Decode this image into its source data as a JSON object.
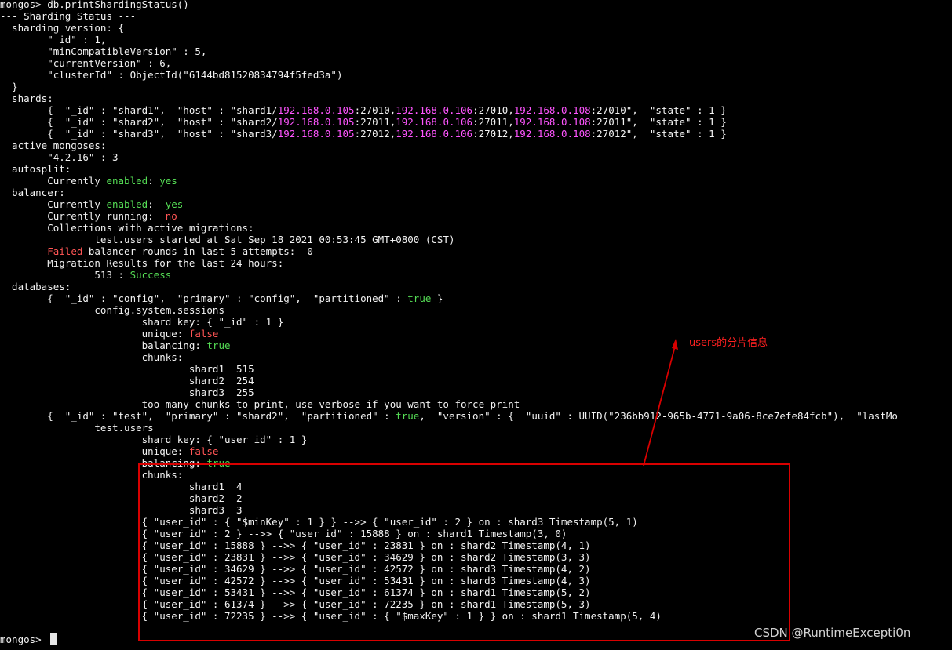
{
  "colors": {
    "background": "#000000",
    "text": "#f2f2f2",
    "ip_address": "#ff55ff",
    "positive": "#55dd55",
    "negative": "#ff5555",
    "annotation": "#d90000"
  },
  "terminal": {
    "lines": [
      [
        {
          "t": "mongos> db.printShardingStatus()",
          "c": "default"
        }
      ],
      [
        {
          "t": "--- Sharding Status --- ",
          "c": "default"
        }
      ],
      [
        {
          "t": "  sharding version: {",
          "c": "default"
        }
      ],
      [
        {
          "t": "        \"_id\" : 1,",
          "c": "default"
        }
      ],
      [
        {
          "t": "        \"minCompatibleVersion\" : 5,",
          "c": "default"
        }
      ],
      [
        {
          "t": "        \"currentVersion\" : 6,",
          "c": "default"
        }
      ],
      [
        {
          "t": "        \"clusterId\" : ObjectId(\"6144bd81520834794f5fed3a\")",
          "c": "default"
        }
      ],
      [
        {
          "t": "  }",
          "c": "default"
        }
      ],
      [
        {
          "t": "  shards:",
          "c": "default"
        }
      ],
      [
        {
          "t": "        {  \"_id\" : \"shard1\",  \"host\" : \"shard1/",
          "c": "default"
        },
        {
          "t": "192.168.0.105",
          "c": "ip"
        },
        {
          "t": ":27010,",
          "c": "default"
        },
        {
          "t": "192.168.0.106",
          "c": "ip"
        },
        {
          "t": ":27010,",
          "c": "default"
        },
        {
          "t": "192.168.0.108",
          "c": "ip"
        },
        {
          "t": ":27010\",  \"state\" : 1 }",
          "c": "default"
        }
      ],
      [
        {
          "t": "        {  \"_id\" : \"shard2\",  \"host\" : \"shard2/",
          "c": "default"
        },
        {
          "t": "192.168.0.105",
          "c": "ip"
        },
        {
          "t": ":27011,",
          "c": "default"
        },
        {
          "t": "192.168.0.106",
          "c": "ip"
        },
        {
          "t": ":27011,",
          "c": "default"
        },
        {
          "t": "192.168.0.108",
          "c": "ip"
        },
        {
          "t": ":27011\",  \"state\" : 1 }",
          "c": "default"
        }
      ],
      [
        {
          "t": "        {  \"_id\" : \"shard3\",  \"host\" : \"shard3/",
          "c": "default"
        },
        {
          "t": "192.168.0.105",
          "c": "ip"
        },
        {
          "t": ":27012,",
          "c": "default"
        },
        {
          "t": "192.168.0.106",
          "c": "ip"
        },
        {
          "t": ":27012,",
          "c": "default"
        },
        {
          "t": "192.168.0.108",
          "c": "ip"
        },
        {
          "t": ":27012\",  \"state\" : 1 }",
          "c": "default"
        }
      ],
      [
        {
          "t": "  active mongoses:",
          "c": "default"
        }
      ],
      [
        {
          "t": "        \"4.2.16\" : 3",
          "c": "default"
        }
      ],
      [
        {
          "t": "  autosplit:",
          "c": "default"
        }
      ],
      [
        {
          "t": "        Currently ",
          "c": "default"
        },
        {
          "t": "enabled",
          "c": "green"
        },
        {
          "t": ": ",
          "c": "default"
        },
        {
          "t": "yes",
          "c": "green"
        }
      ],
      [
        {
          "t": "  balancer:",
          "c": "default"
        }
      ],
      [
        {
          "t": "        Currently ",
          "c": "default"
        },
        {
          "t": "enabled",
          "c": "green"
        },
        {
          "t": ":  ",
          "c": "default"
        },
        {
          "t": "yes",
          "c": "green"
        }
      ],
      [
        {
          "t": "        Currently running:  ",
          "c": "default"
        },
        {
          "t": "no",
          "c": "red"
        }
      ],
      [
        {
          "t": "        Collections with active migrations: ",
          "c": "default"
        }
      ],
      [
        {
          "t": "                test.users started at Sat Sep 18 2021 00:53:45 GMT+0800 (CST)",
          "c": "default"
        }
      ],
      [
        {
          "t": "        ",
          "c": "default"
        },
        {
          "t": "Failed",
          "c": "red"
        },
        {
          "t": " balancer rounds in last 5 attempts:  0",
          "c": "default"
        }
      ],
      [
        {
          "t": "        Migration Results for the last 24 hours: ",
          "c": "default"
        }
      ],
      [
        {
          "t": "                513 : ",
          "c": "default"
        },
        {
          "t": "Success",
          "c": "green"
        }
      ],
      [
        {
          "t": "  databases:",
          "c": "default"
        }
      ],
      [
        {
          "t": "        {  \"_id\" : \"config\",  \"primary\" : \"config\",  \"partitioned\" : ",
          "c": "default"
        },
        {
          "t": "true",
          "c": "green"
        },
        {
          "t": " }",
          "c": "default"
        }
      ],
      [
        {
          "t": "                config.system.sessions",
          "c": "default"
        }
      ],
      [
        {
          "t": "                        shard key: { \"_id\" : 1 }",
          "c": "default"
        }
      ],
      [
        {
          "t": "                        unique: ",
          "c": "default"
        },
        {
          "t": "false",
          "c": "red"
        }
      ],
      [
        {
          "t": "                        balancing: ",
          "c": "default"
        },
        {
          "t": "true",
          "c": "green"
        }
      ],
      [
        {
          "t": "                        chunks:",
          "c": "default"
        }
      ],
      [
        {
          "t": "                                shard1  515",
          "c": "default"
        }
      ],
      [
        {
          "t": "                                shard2  254",
          "c": "default"
        }
      ],
      [
        {
          "t": "                                shard3  255",
          "c": "default"
        }
      ],
      [
        {
          "t": "                        too many chunks to print, use verbose if you want to force print",
          "c": "default"
        }
      ],
      [
        {
          "t": "        {  \"_id\" : \"test\",  \"primary\" : \"shard2\",  \"partitioned\" : ",
          "c": "default"
        },
        {
          "t": "true",
          "c": "green"
        },
        {
          "t": ",  \"version\" : {  \"uuid\" : UUID(\"236bb912-965b-4771-9a06-8ce7efe84fcb\"),  \"lastMo",
          "c": "default"
        }
      ],
      [
        {
          "t": "                test.users",
          "c": "default"
        }
      ],
      [
        {
          "t": "                        shard key: { \"user_id\" : 1 }",
          "c": "default"
        }
      ],
      [
        {
          "t": "                        unique: ",
          "c": "default"
        },
        {
          "t": "false",
          "c": "red"
        }
      ],
      [
        {
          "t": "                        balancing: ",
          "c": "default"
        },
        {
          "t": "true",
          "c": "green"
        }
      ],
      [
        {
          "t": "                        chunks:",
          "c": "default"
        }
      ],
      [
        {
          "t": "                                shard1  4",
          "c": "default"
        }
      ],
      [
        {
          "t": "                                shard2  2",
          "c": "default"
        }
      ],
      [
        {
          "t": "                                shard3  3",
          "c": "default"
        }
      ],
      [
        {
          "t": "                        { \"user_id\" : { \"$minKey\" : 1 } } -->> { \"user_id\" : 2 } on : shard3 Timestamp(5, 1) ",
          "c": "default"
        }
      ],
      [
        {
          "t": "                        { \"user_id\" : 2 } -->> { \"user_id\" : 15888 } on : shard1 Timestamp(3, 0) ",
          "c": "default"
        }
      ],
      [
        {
          "t": "                        { \"user_id\" : 15888 } -->> { \"user_id\" : 23831 } on : shard2 Timestamp(4, 1) ",
          "c": "default"
        }
      ],
      [
        {
          "t": "                        { \"user_id\" : 23831 } -->> { \"user_id\" : 34629 } on : shard2 Timestamp(3, 3) ",
          "c": "default"
        }
      ],
      [
        {
          "t": "                        { \"user_id\" : 34629 } -->> { \"user_id\" : 42572 } on : shard3 Timestamp(4, 2) ",
          "c": "default"
        }
      ],
      [
        {
          "t": "                        { \"user_id\" : 42572 } -->> { \"user_id\" : 53431 } on : shard3 Timestamp(4, 3) ",
          "c": "default"
        }
      ],
      [
        {
          "t": "                        { \"user_id\" : 53431 } -->> { \"user_id\" : 61374 } on : shard1 Timestamp(5, 2) ",
          "c": "default"
        }
      ],
      [
        {
          "t": "                        { \"user_id\" : 61374 } -->> { \"user_id\" : 72235 } on : shard1 Timestamp(5, 3) ",
          "c": "default"
        }
      ],
      [
        {
          "t": "                        { \"user_id\" : 72235 } -->> { \"user_id\" : { \"$maxKey\" : 1 } } on : shard1 Timestamp(5, 4) ",
          "c": "default"
        }
      ],
      [
        {
          "t": "",
          "c": "default"
        }
      ],
      [
        {
          "t": "mongos> ",
          "c": "default"
        }
      ]
    ]
  },
  "annotation": {
    "label": "users的分片信息"
  },
  "watermark": {
    "text": "CSDN @RuntimeExcepti0n"
  }
}
